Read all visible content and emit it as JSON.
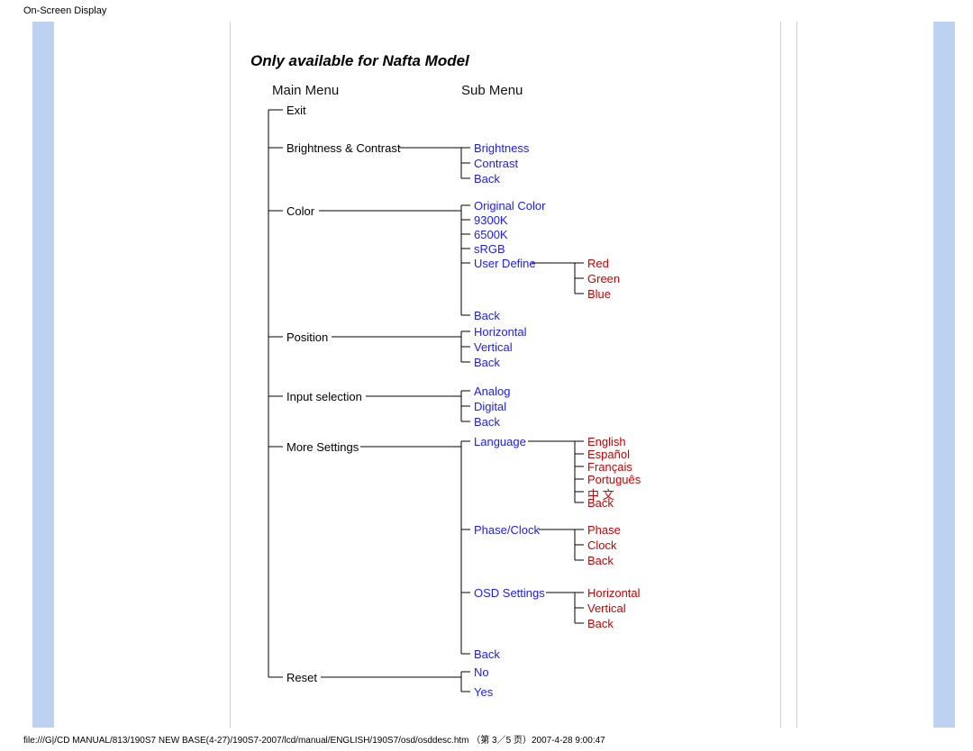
{
  "page_header": "On-Screen Display",
  "footer": "file:///G|/CD MANUAL/813/190S7 NEW BASE(4-27)/190S7-2007/lcd/manual/ENGLISH/190S7/osd/osddesc.htm （第 3／5 页）2007-4-28 9:00:47",
  "title": "Only available for Nafta Model",
  "headers": {
    "main": "Main Menu",
    "sub": "Sub Menu"
  },
  "main": {
    "exit": "Exit",
    "brightness": "Brightness & Contrast",
    "color": "Color",
    "position": "Position",
    "input": "Input selection",
    "more": "More Settings",
    "reset": "Reset"
  },
  "sub": {
    "brightness": [
      "Brightness",
      "Contrast",
      "Back"
    ],
    "color": [
      "Original Color",
      "9300K",
      "6500K",
      "sRGB",
      "User Define",
      "Back"
    ],
    "color_user": [
      "Red",
      "Green",
      "Blue"
    ],
    "position": [
      "Horizontal",
      "Vertical",
      "Back"
    ],
    "input": [
      "Analog",
      "Digital",
      "Back"
    ],
    "more_lang": "Language",
    "lang_opts": [
      "English",
      "Español",
      "Français",
      "Português",
      "中 文",
      "Back"
    ],
    "more_phase": "Phase/Clock",
    "phase_opts": [
      "Phase",
      "Clock",
      "Back"
    ],
    "more_osd": "OSD Settings",
    "osd_opts": [
      "Horizontal",
      "Vertical",
      "Back"
    ],
    "more_back": "Back",
    "reset": [
      "No",
      "Yes"
    ]
  }
}
